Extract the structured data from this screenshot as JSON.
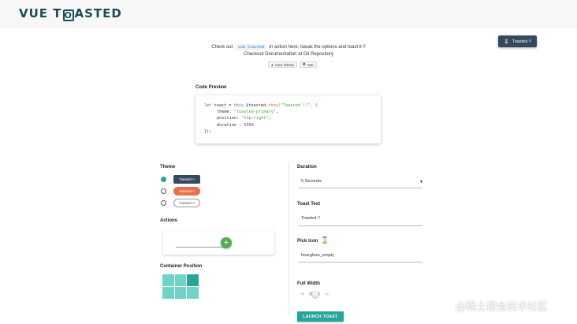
{
  "logo": {
    "pre": "VUE T",
    "box": "O",
    "post": "ASTED"
  },
  "toast": {
    "icon": "hourglass-icon",
    "text": "Toasted !!"
  },
  "intro": {
    "line1_pre": "Check out",
    "line1_code": "vue-toasted",
    "line1_post": "in action here, tweak the options and toast it !!",
    "line2": "Checkout Documentation at Git Repository"
  },
  "github": {
    "view_label": "View Github",
    "star_label": "Star"
  },
  "code_preview": {
    "title": "Code Preview",
    "lines": {
      "l1_kw": "let",
      "l1_var": " toast = ",
      "l1_this": "this",
      "l1_obj": ".$toasted.",
      "l1_fn": "show",
      "l1_arg": "(\"Toasted !!\", {",
      "l2_key": "theme",
      "l2_val": "\"toasted-primary\"",
      "l3_key": "position",
      "l3_val": "\"top-right\"",
      "l4_key": "duration",
      "l4_val": "5000",
      "l5": "});"
    }
  },
  "theme": {
    "title": "Theme",
    "options": [
      {
        "label": "Toasted !!",
        "selected": true
      },
      {
        "label": "Toasted !!",
        "selected": false
      },
      {
        "label": "Toasted !!",
        "selected": false
      }
    ]
  },
  "actions": {
    "title": "Actions",
    "add_icon": "+"
  },
  "container_position": {
    "title": "Container Position",
    "selected": "top-right"
  },
  "duration": {
    "title": "Duration",
    "value": "5 Seconds"
  },
  "toast_text": {
    "title": "Toast Text",
    "value": "Toasted !!"
  },
  "pick_icon": {
    "title": "Pick Icon",
    "value": "hourglass_empty",
    "icon": "hourglass-icon"
  },
  "full_width": {
    "title": "Full Width",
    "off": "Off",
    "on": "On",
    "enabled": false
  },
  "launch_button": "LAUNCH TOAST",
  "watermark": "@稀土掘金技术社区",
  "colors": {
    "accent": "#26a69a",
    "dark": "#35495e",
    "bubble": "#e8704a",
    "add": "#4caf50"
  }
}
